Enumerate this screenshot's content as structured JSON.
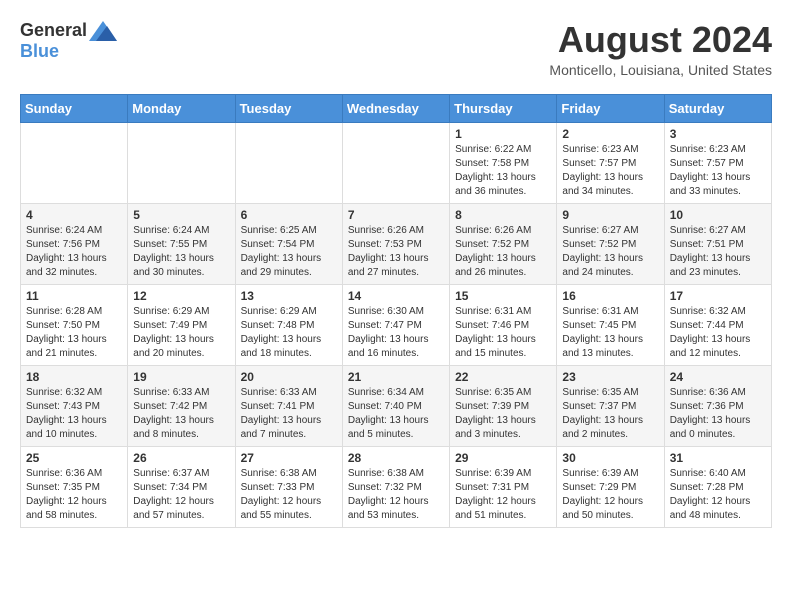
{
  "header": {
    "logo_general": "General",
    "logo_blue": "Blue",
    "month_title": "August 2024",
    "location": "Monticello, Louisiana, United States"
  },
  "days_of_week": [
    "Sunday",
    "Monday",
    "Tuesday",
    "Wednesday",
    "Thursday",
    "Friday",
    "Saturday"
  ],
  "weeks": [
    [
      {
        "day": "",
        "info": ""
      },
      {
        "day": "",
        "info": ""
      },
      {
        "day": "",
        "info": ""
      },
      {
        "day": "",
        "info": ""
      },
      {
        "day": "1",
        "info": "Sunrise: 6:22 AM\nSunset: 7:58 PM\nDaylight: 13 hours\nand 36 minutes."
      },
      {
        "day": "2",
        "info": "Sunrise: 6:23 AM\nSunset: 7:57 PM\nDaylight: 13 hours\nand 34 minutes."
      },
      {
        "day": "3",
        "info": "Sunrise: 6:23 AM\nSunset: 7:57 PM\nDaylight: 13 hours\nand 33 minutes."
      }
    ],
    [
      {
        "day": "4",
        "info": "Sunrise: 6:24 AM\nSunset: 7:56 PM\nDaylight: 13 hours\nand 32 minutes."
      },
      {
        "day": "5",
        "info": "Sunrise: 6:24 AM\nSunset: 7:55 PM\nDaylight: 13 hours\nand 30 minutes."
      },
      {
        "day": "6",
        "info": "Sunrise: 6:25 AM\nSunset: 7:54 PM\nDaylight: 13 hours\nand 29 minutes."
      },
      {
        "day": "7",
        "info": "Sunrise: 6:26 AM\nSunset: 7:53 PM\nDaylight: 13 hours\nand 27 minutes."
      },
      {
        "day": "8",
        "info": "Sunrise: 6:26 AM\nSunset: 7:52 PM\nDaylight: 13 hours\nand 26 minutes."
      },
      {
        "day": "9",
        "info": "Sunrise: 6:27 AM\nSunset: 7:52 PM\nDaylight: 13 hours\nand 24 minutes."
      },
      {
        "day": "10",
        "info": "Sunrise: 6:27 AM\nSunset: 7:51 PM\nDaylight: 13 hours\nand 23 minutes."
      }
    ],
    [
      {
        "day": "11",
        "info": "Sunrise: 6:28 AM\nSunset: 7:50 PM\nDaylight: 13 hours\nand 21 minutes."
      },
      {
        "day": "12",
        "info": "Sunrise: 6:29 AM\nSunset: 7:49 PM\nDaylight: 13 hours\nand 20 minutes."
      },
      {
        "day": "13",
        "info": "Sunrise: 6:29 AM\nSunset: 7:48 PM\nDaylight: 13 hours\nand 18 minutes."
      },
      {
        "day": "14",
        "info": "Sunrise: 6:30 AM\nSunset: 7:47 PM\nDaylight: 13 hours\nand 16 minutes."
      },
      {
        "day": "15",
        "info": "Sunrise: 6:31 AM\nSunset: 7:46 PM\nDaylight: 13 hours\nand 15 minutes."
      },
      {
        "day": "16",
        "info": "Sunrise: 6:31 AM\nSunset: 7:45 PM\nDaylight: 13 hours\nand 13 minutes."
      },
      {
        "day": "17",
        "info": "Sunrise: 6:32 AM\nSunset: 7:44 PM\nDaylight: 13 hours\nand 12 minutes."
      }
    ],
    [
      {
        "day": "18",
        "info": "Sunrise: 6:32 AM\nSunset: 7:43 PM\nDaylight: 13 hours\nand 10 minutes."
      },
      {
        "day": "19",
        "info": "Sunrise: 6:33 AM\nSunset: 7:42 PM\nDaylight: 13 hours\nand 8 minutes."
      },
      {
        "day": "20",
        "info": "Sunrise: 6:33 AM\nSunset: 7:41 PM\nDaylight: 13 hours\nand 7 minutes."
      },
      {
        "day": "21",
        "info": "Sunrise: 6:34 AM\nSunset: 7:40 PM\nDaylight: 13 hours\nand 5 minutes."
      },
      {
        "day": "22",
        "info": "Sunrise: 6:35 AM\nSunset: 7:39 PM\nDaylight: 13 hours\nand 3 minutes."
      },
      {
        "day": "23",
        "info": "Sunrise: 6:35 AM\nSunset: 7:37 PM\nDaylight: 13 hours\nand 2 minutes."
      },
      {
        "day": "24",
        "info": "Sunrise: 6:36 AM\nSunset: 7:36 PM\nDaylight: 13 hours\nand 0 minutes."
      }
    ],
    [
      {
        "day": "25",
        "info": "Sunrise: 6:36 AM\nSunset: 7:35 PM\nDaylight: 12 hours\nand 58 minutes."
      },
      {
        "day": "26",
        "info": "Sunrise: 6:37 AM\nSunset: 7:34 PM\nDaylight: 12 hours\nand 57 minutes."
      },
      {
        "day": "27",
        "info": "Sunrise: 6:38 AM\nSunset: 7:33 PM\nDaylight: 12 hours\nand 55 minutes."
      },
      {
        "day": "28",
        "info": "Sunrise: 6:38 AM\nSunset: 7:32 PM\nDaylight: 12 hours\nand 53 minutes."
      },
      {
        "day": "29",
        "info": "Sunrise: 6:39 AM\nSunset: 7:31 PM\nDaylight: 12 hours\nand 51 minutes."
      },
      {
        "day": "30",
        "info": "Sunrise: 6:39 AM\nSunset: 7:29 PM\nDaylight: 12 hours\nand 50 minutes."
      },
      {
        "day": "31",
        "info": "Sunrise: 6:40 AM\nSunset: 7:28 PM\nDaylight: 12 hours\nand 48 minutes."
      }
    ]
  ]
}
